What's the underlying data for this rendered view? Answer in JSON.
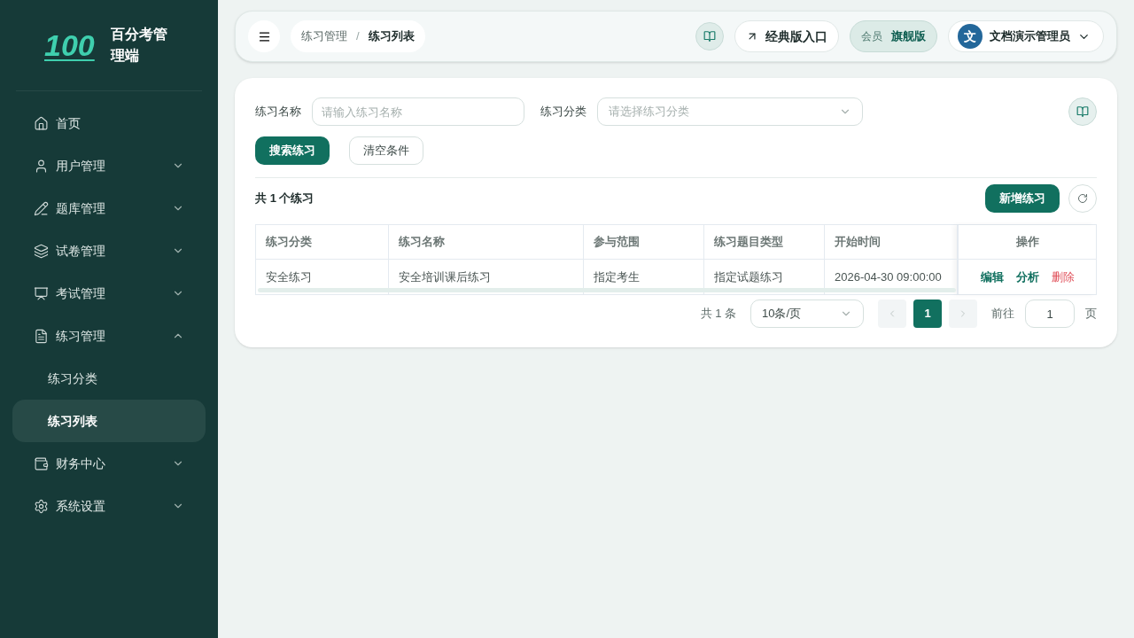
{
  "sidebar": {
    "logo_text": "100",
    "app_title": "百分考管理端",
    "items": [
      {
        "kind": "home",
        "label": "首页"
      },
      {
        "kind": "user",
        "label": "用户管理",
        "expanded": false
      },
      {
        "kind": "pencil",
        "label": "题库管理",
        "expanded": false
      },
      {
        "kind": "papers",
        "label": "试卷管理",
        "expanded": false
      },
      {
        "kind": "exam",
        "label": "考试管理",
        "expanded": false
      },
      {
        "kind": "file",
        "label": "练习管理",
        "expanded": true,
        "children": [
          {
            "label": "练习分类",
            "selected": false
          },
          {
            "label": "练习列表",
            "selected": true
          }
        ]
      },
      {
        "kind": "finance",
        "label": "财务中心",
        "expanded": false
      },
      {
        "kind": "settings",
        "label": "系统设置",
        "expanded": false
      }
    ]
  },
  "header": {
    "breadcrumb": [
      {
        "label": "练习管理",
        "current": false
      },
      {
        "label": "练习列表",
        "current": true
      }
    ],
    "separator": "/",
    "classic_link": "经典版入口",
    "member_label": "会员",
    "member_level": "旗舰版",
    "avatar_letter": "文",
    "user_name": "文档演示管理员"
  },
  "filters": {
    "name_label": "练习名称",
    "name_placeholder": "请输入练习名称",
    "category_label": "练习分类",
    "category_placeholder": "请选择练习分类",
    "search_button": "搜索练习",
    "clear_button": "清空条件"
  },
  "summary": {
    "text": "共 **1** 个练习",
    "add_button": "新增练习"
  },
  "table": {
    "columns": [
      "练习分类",
      "练习名称",
      "参与范围",
      "练习题目类型",
      "开始时间",
      "操作"
    ],
    "rows": [
      {
        "cells": [
          "安全练习",
          "安全培训课后练习",
          "指定考生",
          "指定试题练习",
          "2026-04-30 09:00:00"
        ],
        "actions": [
          {
            "label": "编辑",
            "kind": "normal"
          },
          {
            "label": "分析",
            "kind": "normal"
          },
          {
            "label": "删除",
            "kind": "danger"
          }
        ]
      }
    ]
  },
  "pagination": {
    "total": "共 1 条",
    "page_size": "10条/页",
    "pages": [
      {
        "label": "1",
        "selected": true
      }
    ],
    "goto_label": "前往",
    "goto_value": "1",
    "page_suffix": "页"
  }
}
